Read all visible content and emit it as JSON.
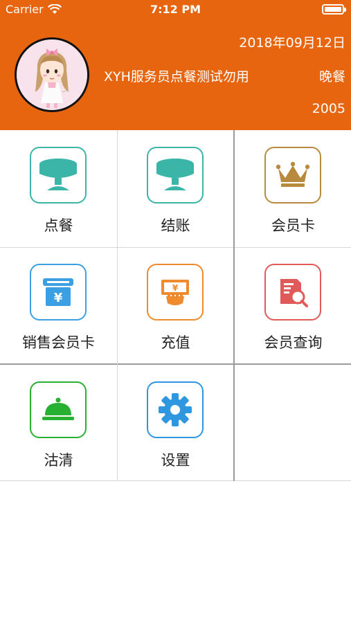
{
  "status_bar": {
    "carrier": "Carrier",
    "time": "7:12 PM"
  },
  "header": {
    "date": "2018年09月12日",
    "staff_name": "XYH服务员点餐测试勿用",
    "meal": "晚餐",
    "code": "2005"
  },
  "menu": [
    {
      "label": "点餐",
      "icon": "dining-table-icon",
      "color": "#3bb5a8"
    },
    {
      "label": "结账",
      "icon": "dining-table-icon",
      "color": "#3bb5a8"
    },
    {
      "label": "会员卡",
      "icon": "crown-icon",
      "color": "#b88a3e"
    },
    {
      "label": "销售会员卡",
      "icon": "yuan-card-icon",
      "color": "#3a9fe3"
    },
    {
      "label": "充值",
      "icon": "recharge-hand-icon",
      "color": "#f08a2e"
    },
    {
      "label": "会员查询",
      "icon": "document-search-icon",
      "color": "#e05a5a"
    },
    {
      "label": "沽清",
      "icon": "food-cloche-icon",
      "color": "#28b030"
    },
    {
      "label": "设置",
      "icon": "gear-icon",
      "color": "#2e97e0"
    }
  ]
}
